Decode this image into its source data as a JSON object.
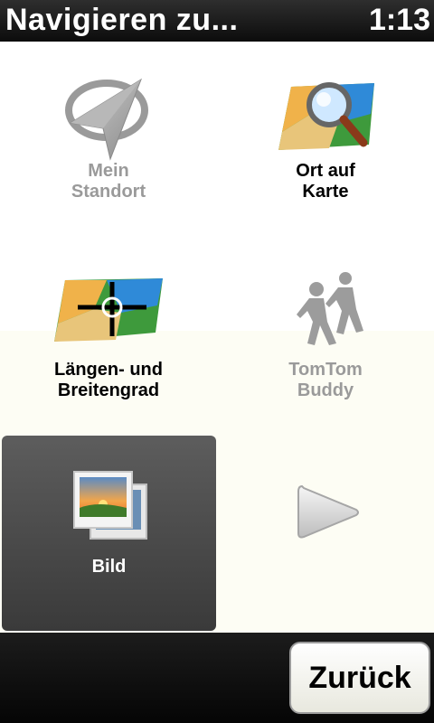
{
  "header": {
    "title": "Navigieren zu...",
    "time": "1:13"
  },
  "menu": {
    "items": [
      {
        "label_line1": "Mein",
        "label_line2": "Standort",
        "icon": "compass-arrow-icon",
        "enabled": false
      },
      {
        "label_line1": "Ort auf",
        "label_line2": "Karte",
        "icon": "map-magnifier-icon",
        "enabled": true
      },
      {
        "label_line1": "Längen- und",
        "label_line2": "Breitengrad",
        "icon": "map-crosshair-icon",
        "enabled": true
      },
      {
        "label_line1": "TomTom",
        "label_line2": "Buddy",
        "icon": "walking-people-icon",
        "enabled": false
      },
      {
        "label_line1": "Bild",
        "label_line2": "",
        "icon": "pictures-icon",
        "enabled": true,
        "selected": true
      }
    ],
    "next_icon": "next-arrow-icon"
  },
  "footer": {
    "back_label": "Zurück"
  },
  "colors": {
    "header_bg": "#1a1a1a",
    "disabled_text": "#9a9a9a",
    "selected_tile": "#4a4a4a",
    "cream_bg": "#fdfdf4"
  }
}
